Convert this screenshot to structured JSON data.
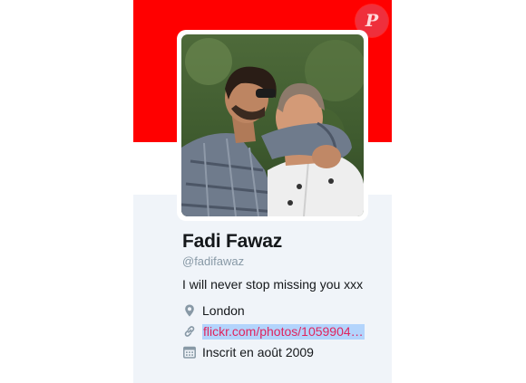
{
  "profile": {
    "name": "Fadi Fawaz",
    "handle": "@fadifawaz",
    "bio": "I will never stop missing you xxx",
    "location": "London",
    "url": "flickr.com/photos/1059904…",
    "joined": "Inscrit en août 2009"
  },
  "badge": {
    "letter": "P"
  },
  "icons": {
    "location": "location-pin-icon",
    "link": "link-icon",
    "calendar": "calendar-icon"
  },
  "colors": {
    "banner": "#ff0000",
    "panel": "#f0f4f9",
    "link": "#e0245e",
    "link_highlight": "#b3d4fc",
    "muted": "#8899a6"
  }
}
